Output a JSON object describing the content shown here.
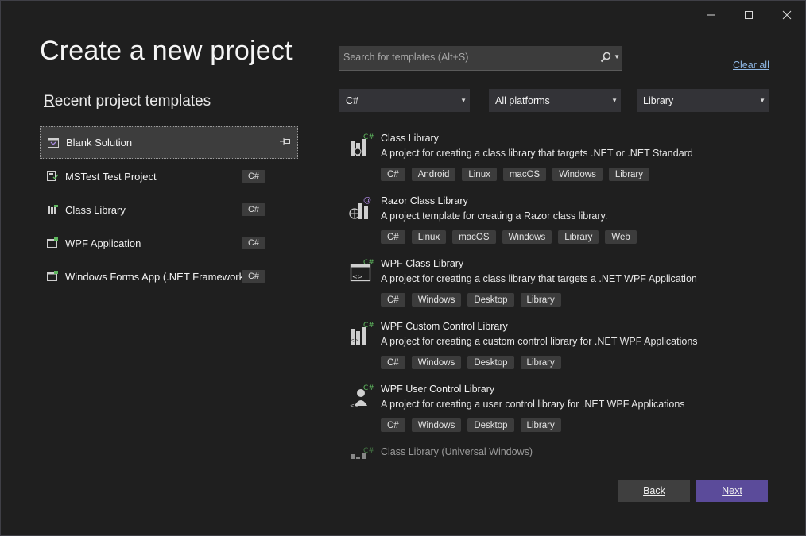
{
  "window": {
    "minimize_icon": "minimize-icon",
    "maximize_icon": "maximize-icon",
    "close_icon": "close-icon"
  },
  "page_title": "Create a new project",
  "recent": {
    "heading": "Recent project templates",
    "items": [
      {
        "name": "Blank Solution",
        "badge": "",
        "pinned": true
      },
      {
        "name": "MSTest Test Project",
        "badge": "C#"
      },
      {
        "name": "Class Library",
        "badge": "C#"
      },
      {
        "name": "WPF Application",
        "badge": "C#"
      },
      {
        "name": "Windows Forms App (.NET Framework)",
        "badge": "C#"
      }
    ]
  },
  "search": {
    "placeholder": "Search for templates (Alt+S)",
    "value": ""
  },
  "clear_all": "Clear all",
  "filters": {
    "language": "C#",
    "platform": "All platforms",
    "project_type": "Library"
  },
  "templates": [
    {
      "name": "Class Library",
      "description": "A project for creating a class library that targets .NET or .NET Standard",
      "tags": [
        "C#",
        "Android",
        "Linux",
        "macOS",
        "Windows",
        "Library"
      ]
    },
    {
      "name": "Razor Class Library",
      "description": "A project template for creating a Razor class library.",
      "tags": [
        "C#",
        "Linux",
        "macOS",
        "Windows",
        "Library",
        "Web"
      ]
    },
    {
      "name": "WPF Class Library",
      "description": "A project for creating a class library that targets a .NET WPF Application",
      "tags": [
        "C#",
        "Windows",
        "Desktop",
        "Library"
      ]
    },
    {
      "name": "WPF Custom Control Library",
      "description": "A project for creating a custom control library for .NET WPF Applications",
      "tags": [
        "C#",
        "Windows",
        "Desktop",
        "Library"
      ]
    },
    {
      "name": "WPF User Control Library",
      "description": "A project for creating a user control library for .NET WPF Applications",
      "tags": [
        "C#",
        "Windows",
        "Desktop",
        "Library"
      ]
    },
    {
      "name": "Class Library (Universal Windows)",
      "description": "",
      "tags": []
    }
  ],
  "buttons": {
    "back": "Back",
    "next": "Next"
  },
  "colors": {
    "accent": "#5b4b9a",
    "link": "#8fb8e6",
    "csharp_green": "#5fb85f"
  }
}
